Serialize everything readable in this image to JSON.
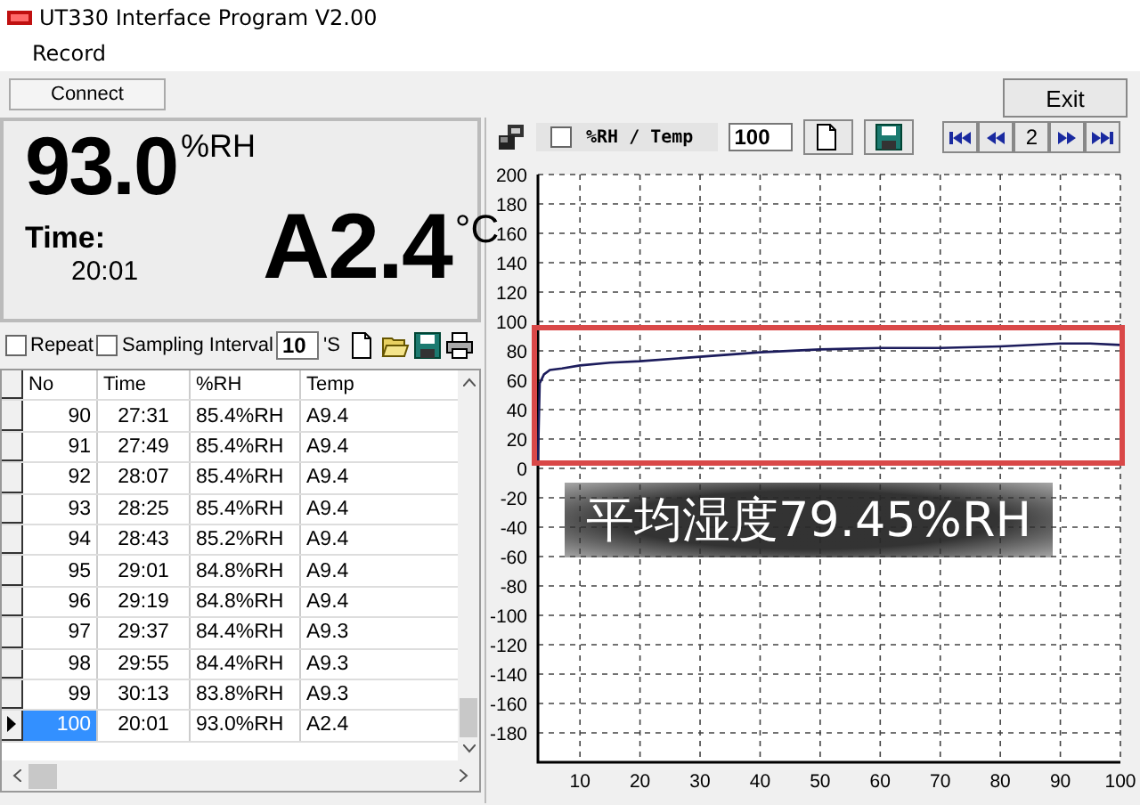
{
  "window": {
    "title": "UT330 Interface Program V2.00"
  },
  "menu": [
    {
      "label": "Record"
    }
  ],
  "connect_button": {
    "label": "Connect"
  },
  "exit_button": {
    "label": "Exit"
  },
  "display": {
    "humidity": "93.0",
    "humidity_unit": "%RH",
    "time_label": "Time:",
    "time": "20:01",
    "temperature": "A2.4",
    "temperature_unit": "°C"
  },
  "options": {
    "repeat": {
      "label": "Repeat",
      "checked": false
    },
    "sampling": {
      "label": "Sampling Interval",
      "checked": false,
      "value": "10",
      "unit": "'S"
    }
  },
  "table": {
    "columns": [
      "No",
      "Time",
      "%RH",
      "Temp"
    ],
    "rows": [
      {
        "cells": [
          "90",
          "27:31",
          "85.4%RH",
          "A9.4"
        ],
        "selected": false
      },
      {
        "cells": [
          "91",
          "27:49",
          "85.4%RH",
          "A9.4"
        ],
        "selected": false
      },
      {
        "cells": [
          "92",
          "28:07",
          "85.4%RH",
          "A9.4"
        ],
        "selected": false
      },
      {
        "cells": [
          "93",
          "28:25",
          "85.4%RH",
          "A9.4"
        ],
        "selected": false
      },
      {
        "cells": [
          "94",
          "28:43",
          "85.2%RH",
          "A9.4"
        ],
        "selected": false
      },
      {
        "cells": [
          "95",
          "29:01",
          "84.8%RH",
          "A9.4"
        ],
        "selected": false
      },
      {
        "cells": [
          "96",
          "29:19",
          "84.8%RH",
          "A9.4"
        ],
        "selected": false
      },
      {
        "cells": [
          "97",
          "29:37",
          "84.4%RH",
          "A9.3"
        ],
        "selected": false
      },
      {
        "cells": [
          "98",
          "29:55",
          "84.4%RH",
          "A9.3"
        ],
        "selected": false
      },
      {
        "cells": [
          "99",
          "30:13",
          "83.8%RH",
          "A9.3"
        ],
        "selected": false
      },
      {
        "cells": [
          "100",
          "20:01",
          "93.0%RH",
          "A2.4"
        ],
        "selected": true
      }
    ]
  },
  "chart_toolbar": {
    "mode_checkbox": {
      "label": "%RH / Temp",
      "checked": false
    },
    "points_value": "100",
    "page": "2"
  },
  "chart_data": {
    "type": "line",
    "x": [
      3,
      3.3,
      4,
      5,
      7,
      10,
      15,
      20,
      30,
      40,
      50,
      60,
      70,
      80,
      90,
      95,
      100
    ],
    "grid": true,
    "series": [
      {
        "color": "#1c1c5c",
        "values": [
          5,
          58,
          64,
          67,
          68,
          70,
          72,
          73,
          76,
          79,
          81,
          82,
          82,
          83,
          85,
          85,
          84
        ]
      }
    ],
    "xlim": [
      3,
      100
    ],
    "ylim": [
      -200,
      200
    ],
    "xticks": [
      10,
      20,
      30,
      40,
      50,
      60,
      70,
      80,
      90,
      100
    ],
    "yticks": [
      -180,
      -160,
      -140,
      -120,
      -100,
      -80,
      -60,
      -40,
      -20,
      0,
      20,
      40,
      60,
      80,
      100,
      120,
      140,
      160,
      180,
      200
    ]
  },
  "overlay_caption": "平均湿度79.45%RH"
}
